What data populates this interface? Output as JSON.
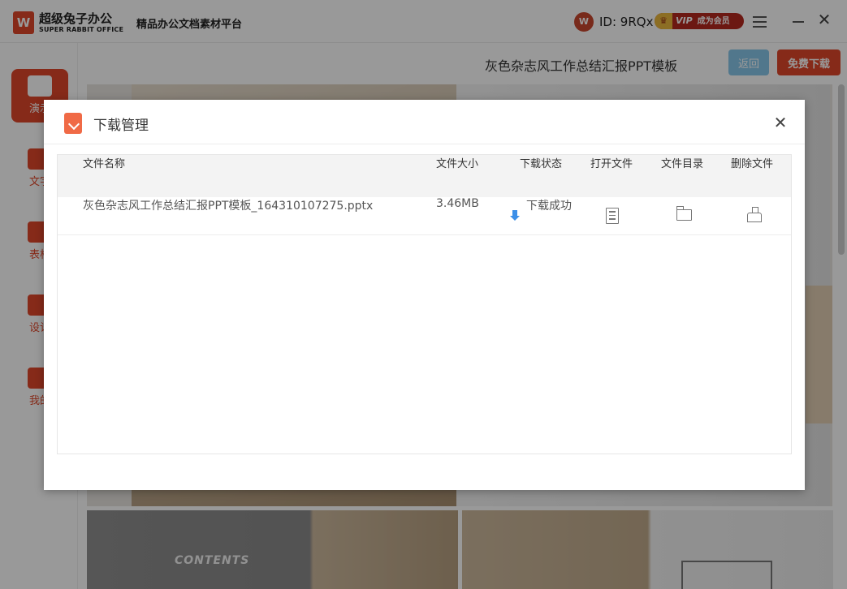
{
  "app": {
    "logo_mark": "W",
    "name_cn": "超级兔子办公",
    "name_en": "SUPER RABBIT OFFICE",
    "platform": "精品办公文档素材平台"
  },
  "user": {
    "avatar_letter": "W",
    "id_text": "ID: 9RQx",
    "vip_label": "VIP",
    "vip_join": "成为会员"
  },
  "sidebar": {
    "items": [
      {
        "label": "演示"
      },
      {
        "label": "文字"
      },
      {
        "label": "表格"
      },
      {
        "label": "设计"
      },
      {
        "label": "我的"
      }
    ]
  },
  "main": {
    "title": "灰色杂志风工作总结汇报PPT模板",
    "back_label": "返回",
    "free_download_label": "免费下载",
    "thumb_text": "CONTENTS"
  },
  "colors": {
    "accent": "#e0472a",
    "back_button": "#88c6ea",
    "status_blue": "#3b8fe8"
  },
  "modal": {
    "title": "下载管理",
    "columns": [
      "文件名称",
      "文件大小",
      "下载状态",
      "打开文件",
      "文件目录",
      "删除文件"
    ],
    "rows": [
      {
        "file_name": "灰色杂志风工作总结汇报PPT模板_164310107275.pptx",
        "size": "3.46MB",
        "status": "下载成功",
        "open_icon": "document-icon",
        "dir_icon": "folder-icon",
        "delete_icon": "broom-icon"
      }
    ]
  }
}
